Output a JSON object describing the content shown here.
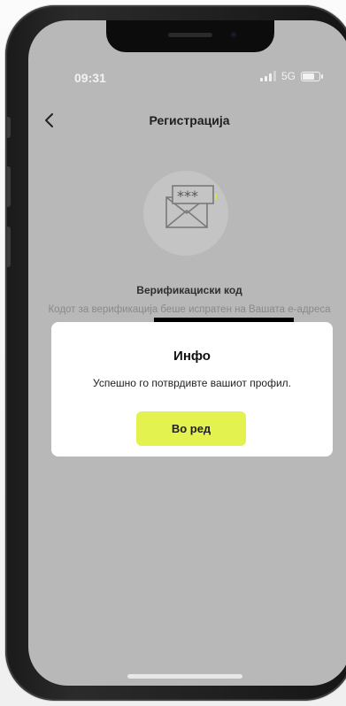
{
  "status_bar": {
    "time": "09:31",
    "network": "5G"
  },
  "header": {
    "back_icon": "chevron-left-icon",
    "title": "Регистрација"
  },
  "verification": {
    "icon": "envelope-password-icon",
    "title": "Верификациски код",
    "description": "Кодот за верификација беше испратен на Вашата е-адреса"
  },
  "dialog": {
    "title": "Инфо",
    "message": "Успешно го потврдивте вашиот профил.",
    "ok_label": "Во ред"
  },
  "colors": {
    "accent": "#e4f250",
    "overlay_background": "#b8b8b8",
    "dialog_background": "#ffffff"
  }
}
